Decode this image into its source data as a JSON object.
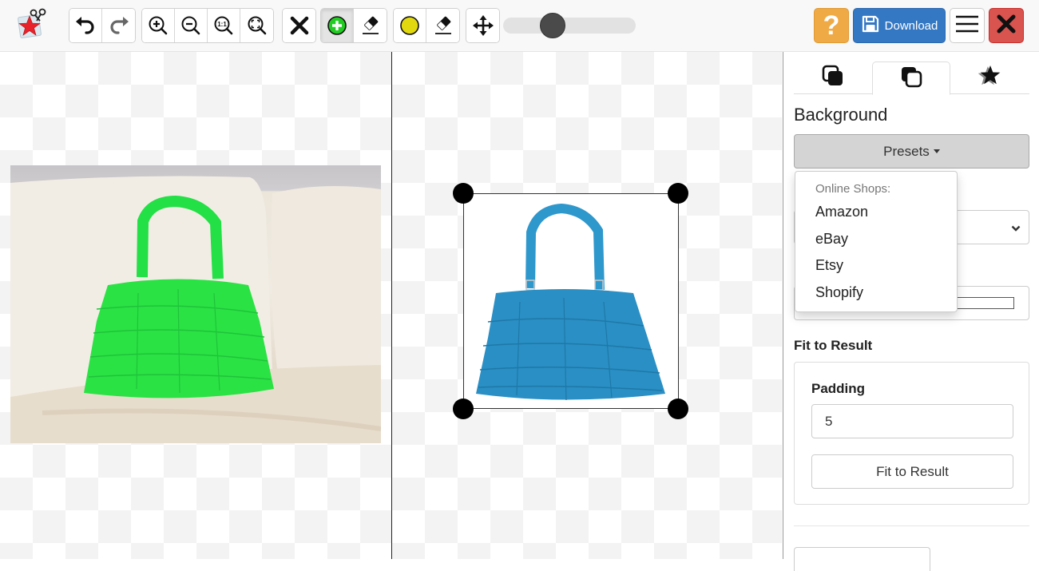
{
  "toolbar": {
    "logo": "clipping-magic-logo",
    "history": [
      {
        "name": "undo",
        "icon": "undo-icon"
      },
      {
        "name": "redo",
        "icon": "redo-icon"
      }
    ],
    "zoom": [
      {
        "name": "zoom-in",
        "icon": "zoom-in-icon"
      },
      {
        "name": "zoom-out",
        "icon": "zoom-out-icon"
      },
      {
        "name": "zoom-actual",
        "icon": "zoom-actual-size-icon",
        "text": "1:1"
      },
      {
        "name": "zoom-fit",
        "icon": "zoom-fit-icon"
      }
    ],
    "clear": {
      "icon": "close-x-icon"
    },
    "mark_tools": [
      {
        "name": "keep-marker",
        "icon": "plus-circle-icon",
        "color": "#22cc22",
        "active": true
      },
      {
        "name": "eraser",
        "icon": "eraser-icon",
        "active": false
      }
    ],
    "hair_tools": [
      {
        "name": "hair-marker",
        "icon": "yellow-circle-icon",
        "color": "#e1d80f"
      },
      {
        "name": "hair-eraser",
        "icon": "eraser-icon"
      }
    ],
    "pan": {
      "icon": "move-arrows-icon"
    },
    "brush_size_slider": {
      "value_fraction": 0.34
    },
    "help": {
      "label": "?",
      "color": "#efaa45"
    },
    "download": {
      "label": "Download",
      "color": "#3478c4",
      "icon": "floppy-disk-icon"
    },
    "menu": {
      "icon": "hamburger-icon"
    },
    "exit": {
      "icon": "close-x-icon",
      "color": "#d9534f"
    }
  },
  "canvas": {
    "left_pane": {
      "description": "Original photo of green crocodile-textured handbag on white sofa",
      "mark_color": "#22ee44"
    },
    "right_pane": {
      "description": "Result preview of blue crocodile-textured handbag on white background with crop handles",
      "bag_color": "#2a8fc4"
    }
  },
  "sidebar": {
    "tabs": [
      {
        "name": "tab-layers-filled",
        "icon": "layers-filled-icon",
        "active": false
      },
      {
        "name": "tab-layers-outline",
        "icon": "layers-outline-icon",
        "active": true
      },
      {
        "name": "tab-star",
        "icon": "star-icon",
        "active": false
      }
    ],
    "background_title": "Background",
    "presets_label": "Presets",
    "presets_dropdown": {
      "header": "Online Shops:",
      "items": [
        "Amazon",
        "eBay",
        "Etsy",
        "Shopify"
      ]
    },
    "fit_title": "Fit to Result",
    "padding_label": "Padding",
    "padding_value": "5",
    "fit_button_label": "Fit to Result"
  }
}
